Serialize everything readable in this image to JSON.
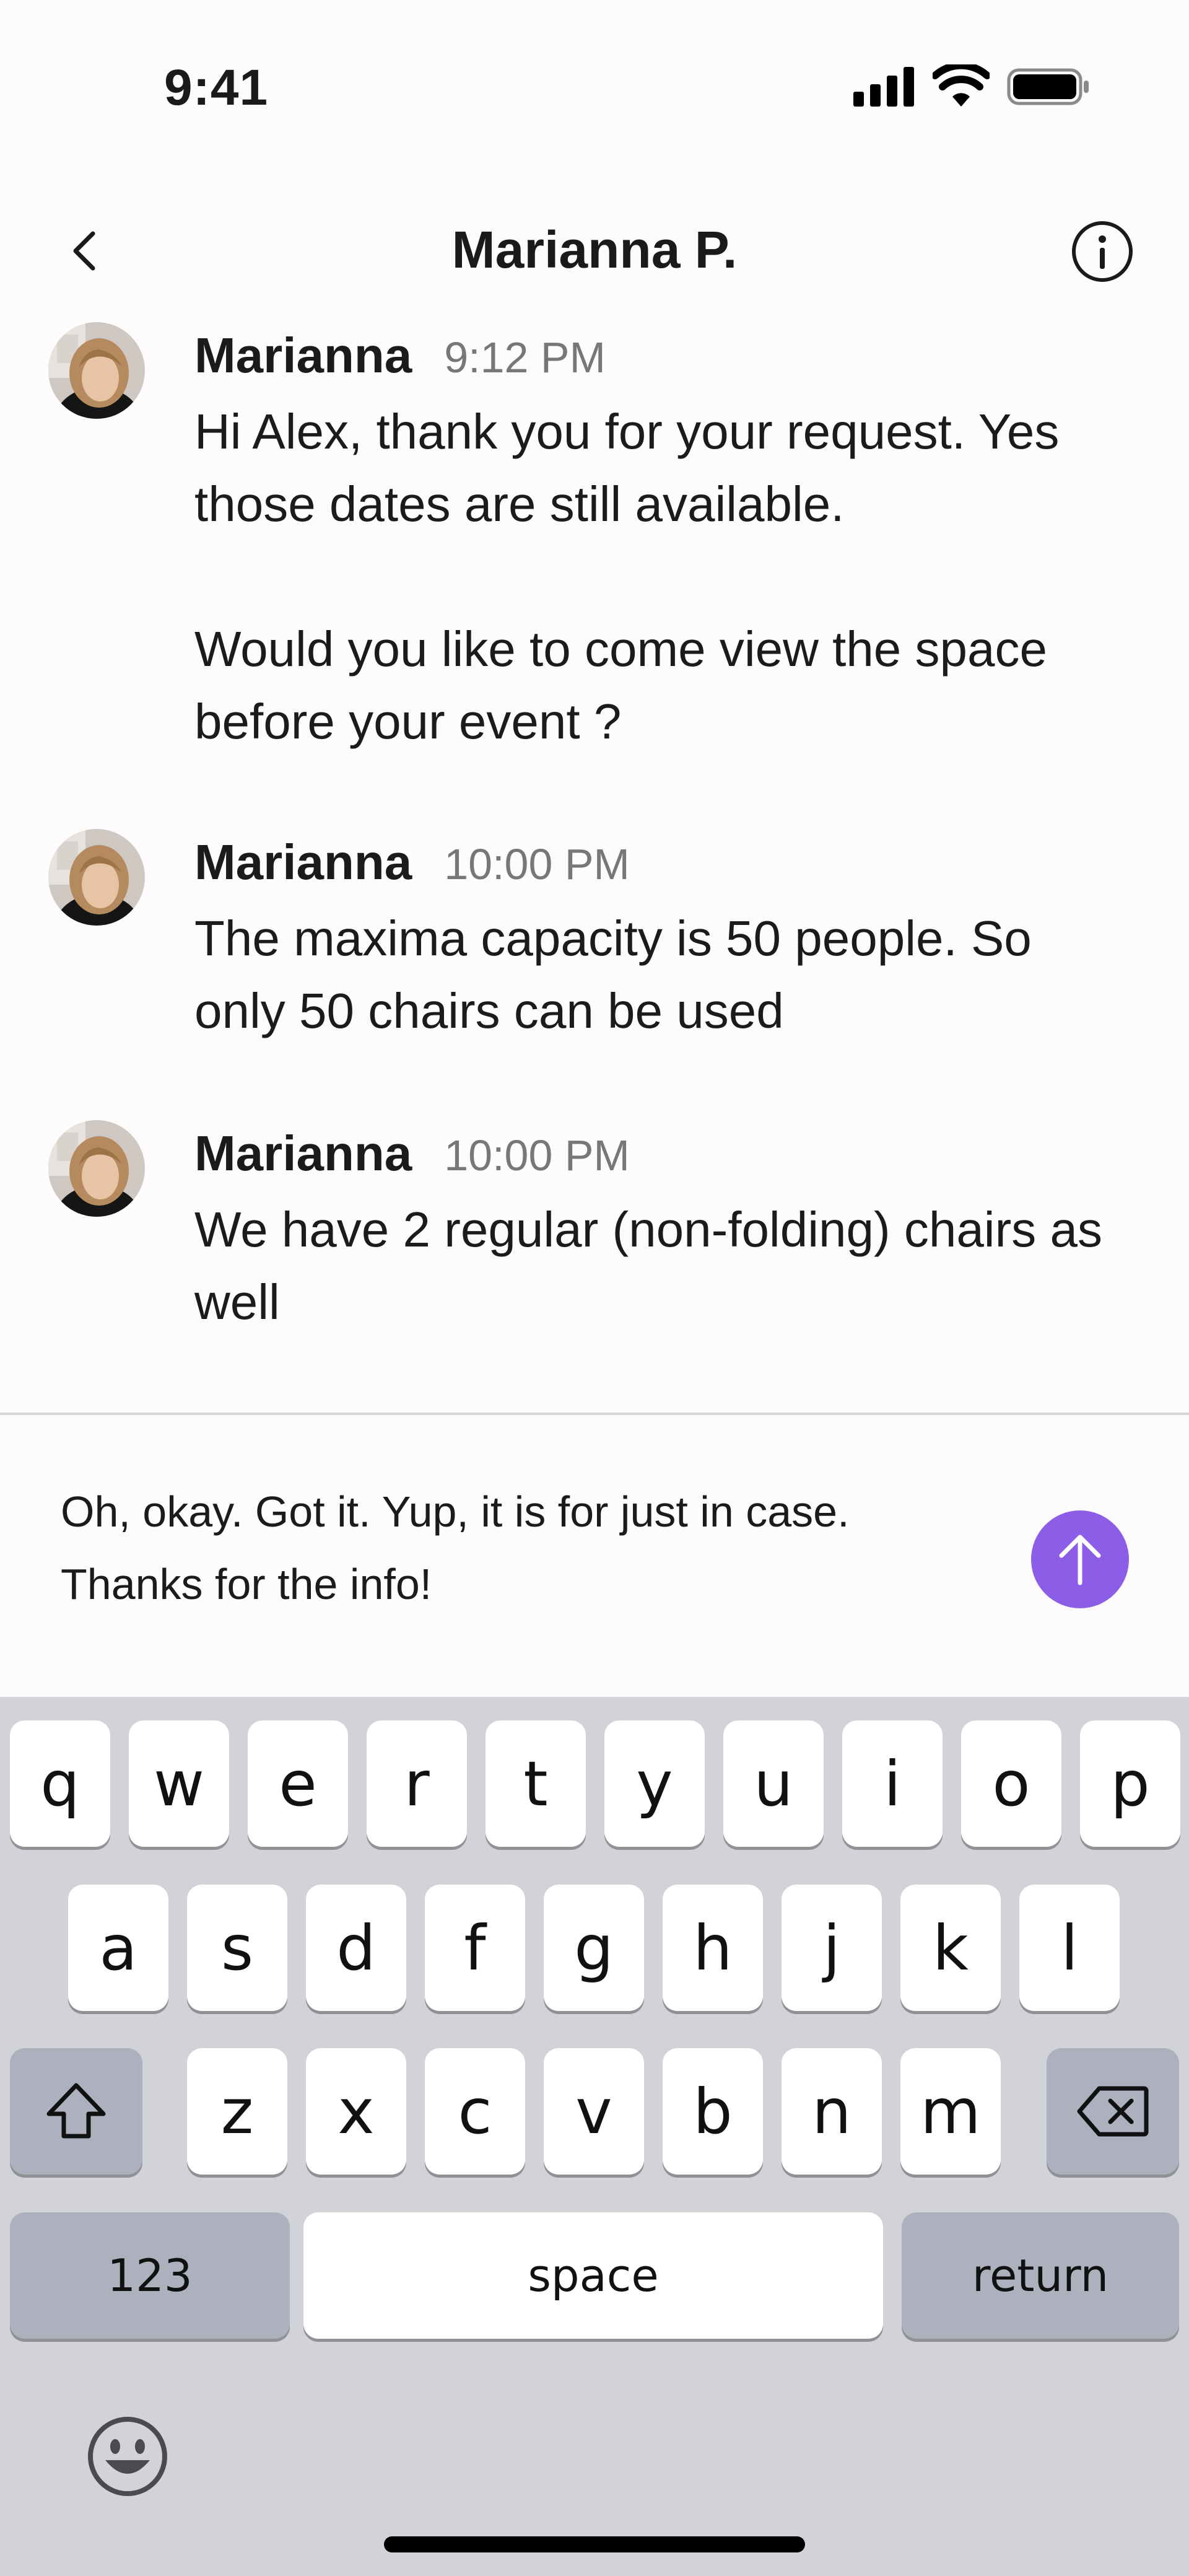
{
  "status_bar": {
    "time": "9:41"
  },
  "header": {
    "title": "Marianna P."
  },
  "messages": [
    {
      "sender": "Marianna",
      "time": "9:12 PM",
      "paragraphs": [
        "Hi Alex, thank you for your request. Yes those dates are still available.",
        "Would you like to come view the space before your event ?"
      ]
    },
    {
      "sender": "Marianna",
      "time": "10:00 PM",
      "paragraphs": [
        "The maxima capacity is 50 people. So only 50 chairs can be used"
      ]
    },
    {
      "sender": "Marianna",
      "time": "10:00 PM",
      "paragraphs": [
        "We have 2 regular (non-folding) chairs as well"
      ]
    }
  ],
  "composer": {
    "text": "Oh, okay. Got it. Yup, it is for just in case.\nThanks for the info!"
  },
  "keyboard": {
    "row1": [
      "q",
      "w",
      "e",
      "r",
      "t",
      "y",
      "u",
      "i",
      "o",
      "p"
    ],
    "row2": [
      "a",
      "s",
      "d",
      "f",
      "g",
      "h",
      "j",
      "k",
      "l"
    ],
    "row3": [
      "z",
      "x",
      "c",
      "v",
      "b",
      "n",
      "m"
    ],
    "numbers_label": "123",
    "space_label": "space",
    "return_label": "return"
  },
  "colors": {
    "accent": "#8c5ee8",
    "keyboard_bg": "#d2d3d9",
    "func_key": "#acb1bd"
  }
}
